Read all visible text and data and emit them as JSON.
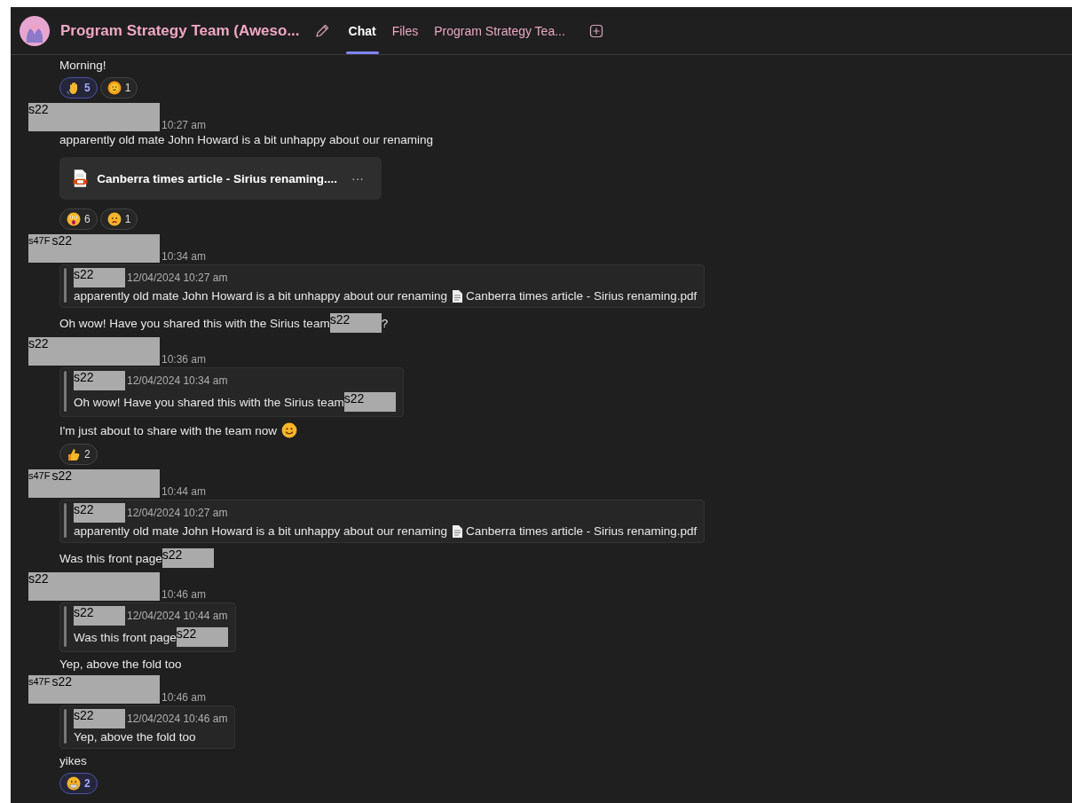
{
  "header": {
    "title": "Program Strategy Team (Aweso...",
    "tabs": [
      {
        "label": "Chat",
        "selected": true
      },
      {
        "label": "Files",
        "selected": false
      },
      {
        "label": "Program Strategy Tea...",
        "selected": false
      }
    ]
  },
  "messages": [
    {
      "parts": [
        {
          "kind": "text",
          "text": "Morning!"
        }
      ],
      "reactions": [
        {
          "kind": "wave",
          "count": "5",
          "selected": true
        },
        {
          "kind": "sun",
          "count": "1",
          "selected": false
        }
      ]
    },
    {
      "sender": {
        "redactions": [
          "s22"
        ],
        "time": "10:27 am"
      },
      "parts": [
        {
          "kind": "text",
          "text": "apparently old mate John Howard is a bit unhappy about our renaming"
        }
      ],
      "attachment": {
        "name": "Canberra times article - Sirius renaming....",
        "more": "···"
      },
      "reactions": [
        {
          "kind": "shock",
          "count": "6",
          "selected": false
        },
        {
          "kind": "frown",
          "count": "1",
          "selected": false
        }
      ]
    },
    {
      "sender": {
        "redactions": [
          "s47F",
          "s22"
        ],
        "time": "10:34 am"
      },
      "quote": {
        "author": "s22",
        "timestamp": "12/04/2024 10:27 am",
        "parts": [
          {
            "kind": "text",
            "text": "apparently old mate John Howard is a bit unhappy about our renaming"
          },
          {
            "kind": "file",
            "text": "Canberra times article - Sirius renaming.pdf"
          }
        ]
      },
      "parts": [
        {
          "kind": "text",
          "text": "Oh wow! Have you shared this with the Sirius team"
        },
        {
          "kind": "redaction",
          "text": "s22"
        },
        {
          "kind": "text",
          "text": "?"
        }
      ]
    },
    {
      "sender": {
        "redactions": [
          "s22"
        ],
        "time": "10:36 am"
      },
      "quote": {
        "author": "s22",
        "timestamp": "12/04/2024 10:34 am",
        "parts": [
          {
            "kind": "text",
            "text": "Oh wow! Have you shared this with the Sirius team"
          },
          {
            "kind": "redaction",
            "text": "s22"
          }
        ]
      },
      "parts": [
        {
          "kind": "text",
          "text": "I'm just about to share with the team now"
        },
        {
          "kind": "smile"
        }
      ],
      "reactions": [
        {
          "kind": "thumbs",
          "count": "2",
          "selected": false
        }
      ]
    },
    {
      "sender": {
        "redactions": [
          "s47F",
          "s22"
        ],
        "time": "10:44 am"
      },
      "quote": {
        "author": "s22",
        "timestamp": "12/04/2024 10:27 am",
        "parts": [
          {
            "kind": "text",
            "text": "apparently old mate John Howard is a bit unhappy about our renaming"
          },
          {
            "kind": "file",
            "text": "Canberra times article - Sirius renaming.pdf"
          }
        ]
      },
      "parts": [
        {
          "kind": "text",
          "text": "Was this front page"
        },
        {
          "kind": "redaction",
          "text": "s22"
        }
      ]
    },
    {
      "sender": {
        "redactions": [
          "s22"
        ],
        "time": "10:46 am"
      },
      "quote": {
        "author": "s22",
        "timestamp": "12/04/2024 10:44 am",
        "parts": [
          {
            "kind": "text",
            "text": "Was this front page"
          },
          {
            "kind": "redaction",
            "text": "s22"
          }
        ]
      },
      "parts": [
        {
          "kind": "text",
          "text": "Yep, above the fold too"
        }
      ]
    },
    {
      "sender": {
        "redactions": [
          "s47F",
          "s22"
        ],
        "time": "10:46 am"
      },
      "quote": {
        "author": "s22",
        "timestamp": "12/04/2024 10:46 am",
        "parts": [
          {
            "kind": "text",
            "text": "Yep, above the fold too"
          }
        ]
      },
      "parts": [
        {
          "kind": "text",
          "text": "yikes"
        }
      ],
      "reactions": [
        {
          "kind": "grimace",
          "count": "2",
          "selected": true
        }
      ]
    }
  ]
}
